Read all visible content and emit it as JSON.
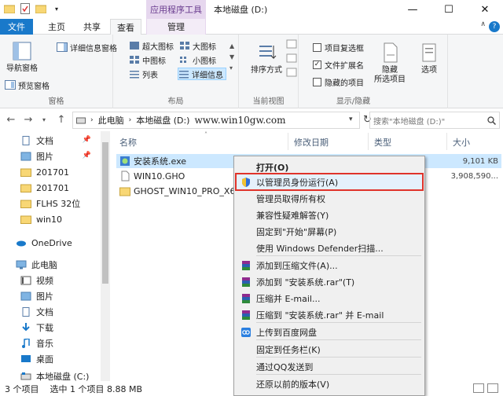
{
  "title_bar": {
    "context_tab_title": "应用程序工具",
    "window_title": "本地磁盘 (D:)",
    "minimize": "—",
    "maximize": "☐",
    "close": "✕"
  },
  "ribbon_tabs": {
    "file": "文件",
    "home": "主页",
    "share": "共享",
    "view": "查看",
    "manage": "管理"
  },
  "ribbon": {
    "panes": {
      "nav_pane": "导航窗格",
      "preview_pane": "预览窗格",
      "details_pane": "详细信息窗格",
      "label": "窗格"
    },
    "layout": {
      "extra_large": "超大图标",
      "large": "大图标",
      "medium": "中图标",
      "small": "小图标",
      "list": "列表",
      "details": "详细信息",
      "label": "布局"
    },
    "current_view": {
      "sort_by": "排序方式",
      "label": "当前视图"
    },
    "show_hide": {
      "item_checkboxes": "项目复选框",
      "file_extensions": "文件扩展名",
      "hidden_items": "隐藏的项目",
      "hide_selected": "隐藏",
      "hide_selected_2": "所选项目",
      "options": "选项",
      "label": "显示/隐藏",
      "file_extensions_checked": true
    }
  },
  "address": {
    "crumbs": [
      "此电脑",
      "本地磁盘 (D:)"
    ],
    "watermark": "www.win10gw.com",
    "search_placeholder": "搜索\"本地磁盘 (D:)\""
  },
  "nav_pane": {
    "items": [
      {
        "label": "文档",
        "icon": "document-icon",
        "pinned": true
      },
      {
        "label": "图片",
        "icon": "pictures-icon",
        "pinned": true
      },
      {
        "label": "201701",
        "icon": "folder-icon"
      },
      {
        "label": "201701",
        "icon": "folder-icon"
      },
      {
        "label": "FLHS 32位",
        "icon": "folder-icon"
      },
      {
        "label": "win10",
        "icon": "folder-icon"
      },
      {
        "label": "OneDrive",
        "icon": "onedrive-icon"
      },
      {
        "label": "此电脑",
        "icon": "computer-icon"
      },
      {
        "label": "视频",
        "icon": "video-icon"
      },
      {
        "label": "图片",
        "icon": "pictures-icon"
      },
      {
        "label": "文档",
        "icon": "document-icon"
      },
      {
        "label": "下载",
        "icon": "download-icon"
      },
      {
        "label": "音乐",
        "icon": "music-icon"
      },
      {
        "label": "桌面",
        "icon": "desktop-icon"
      },
      {
        "label": "本地磁盘 (C:)",
        "icon": "drive-icon"
      }
    ],
    "pin_glyph": "📌"
  },
  "file_list": {
    "columns": {
      "name": "名称",
      "modified": "修改日期",
      "type": "类型",
      "size": "大小"
    },
    "rows": [
      {
        "name": "安装系统.exe",
        "size": "9,101 KB",
        "selected": true
      },
      {
        "name": "WIN10.GHO",
        "size": "3,908,590..."
      },
      {
        "name": "GHOST_WIN10_PRO_X64_",
        "size": ""
      }
    ]
  },
  "context_menu": {
    "items": [
      {
        "label": "打开(O)",
        "bold": true
      },
      {
        "label": "以管理员身份运行(A)",
        "icon": "shield-icon",
        "highlighted": true
      },
      {
        "label": "管理员取得所有权"
      },
      {
        "label": "兼容性疑难解答(Y)"
      },
      {
        "label": "固定到\"开始\"屏幕(P)"
      },
      {
        "label": "使用 Windows Defender扫描..."
      },
      {
        "label": "添加到压缩文件(A)...",
        "icon": "winrar-icon"
      },
      {
        "label": "添加到 \"安装系统.rar\"(T)",
        "icon": "winrar-icon"
      },
      {
        "label": "压缩并 E-mail...",
        "icon": "winrar-icon"
      },
      {
        "label": "压缩到 \"安装系统.rar\" 并 E-mail",
        "icon": "winrar-icon"
      },
      {
        "label": "上传到百度网盘",
        "icon": "baidu-cloud-icon"
      },
      {
        "label": "固定到任务栏(K)"
      },
      {
        "label": "通过QQ发送到"
      },
      {
        "label": "还原以前的版本(V)"
      }
    ]
  },
  "status_bar": {
    "count": "3 个项目",
    "selection": "选中 1 个项目  8.88 MB"
  },
  "colors": {
    "accent": "#1979ca",
    "manage_tab": "#e6d7ee",
    "selection": "#cce8ff",
    "highlight_border": "#e0332a",
    "folder": "#f8d775"
  }
}
